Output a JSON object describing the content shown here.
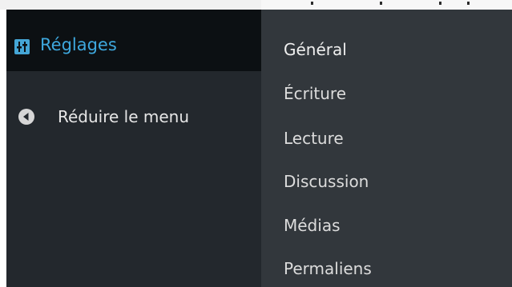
{
  "admin_menu": {
    "active_item": {
      "label": "Réglages",
      "icon": "settings-sliders-icon"
    },
    "collapse": {
      "label": "Réduire le menu",
      "icon": "collapse-arrow-icon"
    }
  },
  "submenu": {
    "items": [
      {
        "label": "Général"
      },
      {
        "label": "Écriture"
      },
      {
        "label": "Lecture"
      },
      {
        "label": "Discussion"
      },
      {
        "label": "Médias"
      },
      {
        "label": "Permaliens"
      }
    ]
  },
  "colors": {
    "menu_background": "#23282d",
    "active_item_background": "#0c1013",
    "submenu_background": "#32373c",
    "accent": "#3ea8de",
    "text": "#e6e6e6"
  }
}
